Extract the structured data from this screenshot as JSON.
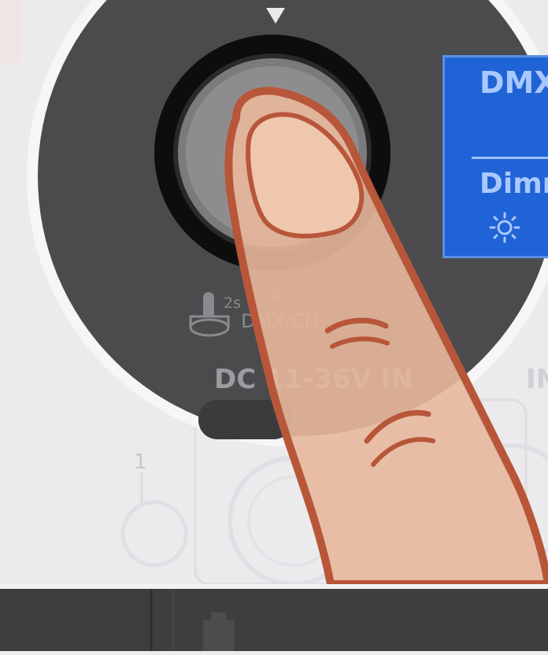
{
  "panel": {
    "power_label": "DC 11-36V IN",
    "hold_time": "2s",
    "hold_action": "DMX/CH",
    "right_label": "IN",
    "port_number": "1"
  },
  "display": {
    "line1": "DMX",
    "line2": "Dimm",
    "icon": "brightness-icon"
  },
  "colors": {
    "panel_dark": "#4a4a4c",
    "display_blue": "#1f63d6",
    "finger": "#e8b89c",
    "finger_outline": "#b8563a"
  }
}
